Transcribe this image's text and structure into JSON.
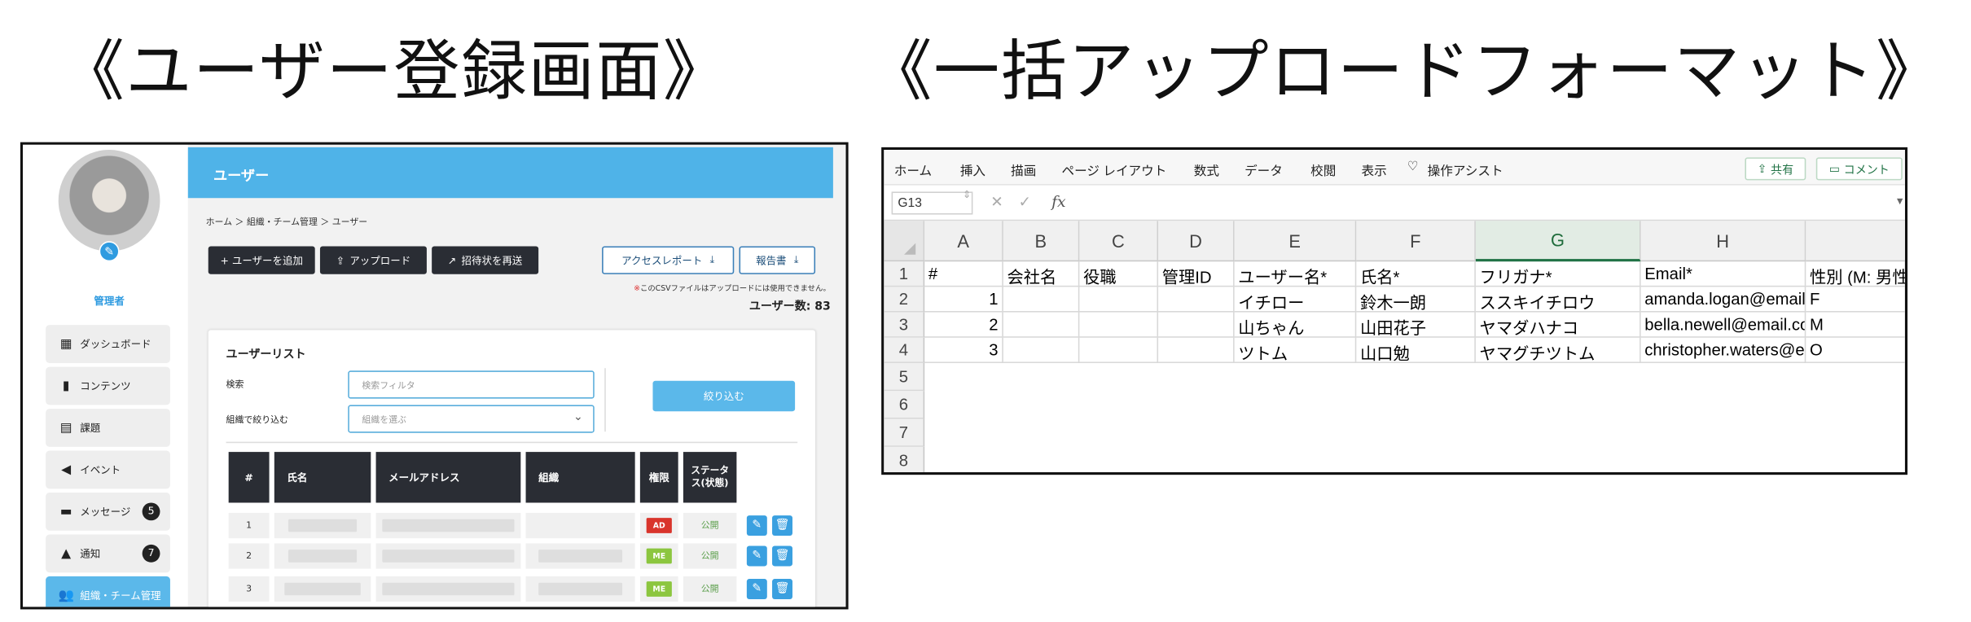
{
  "titles": {
    "left": "《ユーザー登録画面》",
    "right": "《一括アップロードフォーマット》"
  },
  "registration": {
    "role_label": "管理者",
    "nav": [
      {
        "label": "ダッシュボード",
        "icon": "grid-icon"
      },
      {
        "label": "コンテンツ",
        "icon": "book-icon"
      },
      {
        "label": "課題",
        "icon": "task-icon"
      },
      {
        "label": "イベント",
        "icon": "megaphone-icon"
      },
      {
        "label": "メッセージ",
        "icon": "chat-icon",
        "badge": "5"
      },
      {
        "label": "通知",
        "icon": "bell-icon",
        "badge": "7"
      },
      {
        "label": "組織・チーム管理",
        "icon": "people-icon",
        "active": true
      }
    ],
    "header_title": "ユーザー",
    "breadcrumb": "ホーム ＞ 組織・チーム管理 ＞ ユーザー",
    "buttons": {
      "add_user": "+ ユーザーを追加",
      "upload": "アップロード",
      "resend_invite": "招待状を再送",
      "access_report": "アクセスレポート",
      "report": "報告書"
    },
    "csv_note_mark": "※",
    "csv_note": "このCSVファイルはアップロードには使用できません。",
    "user_count": "ユーザー数: 83",
    "list": {
      "title": "ユーザーリスト",
      "search_label": "検索",
      "search_placeholder": "検索フィルタ",
      "org_filter_label": "組織で絞り込む",
      "org_filter_placeholder": "組織を選ぶ",
      "filter_button": "絞り込む",
      "columns": [
        "#",
        "氏名",
        "メールアドレス",
        "組織",
        "権限",
        "ステータス(状態)"
      ],
      "rows": [
        {
          "num": "1",
          "role": "AD",
          "role_color": "#d9342b",
          "status": "公開"
        },
        {
          "num": "2",
          "role": "ME",
          "role_color": "#8cc63f",
          "status": "公開"
        },
        {
          "num": "3",
          "role": "ME",
          "role_color": "#8cc63f",
          "status": "公開"
        }
      ]
    }
  },
  "spreadsheet": {
    "ribbon_tabs": [
      "ホーム",
      "挿入",
      "描画",
      "ページ レイアウト",
      "数式",
      "データ",
      "校閲",
      "表示",
      "操作アシスト"
    ],
    "share_button": "共有",
    "comment_button": "コメント",
    "name_box": "G13",
    "fx_label": "fx",
    "columns": [
      "A",
      "B",
      "C",
      "D",
      "E",
      "F",
      "G",
      "H"
    ],
    "selected_column": "G",
    "row_numbers": [
      "1",
      "2",
      "3",
      "4",
      "5",
      "6",
      "7",
      "8"
    ],
    "header_row": [
      "#",
      "会社名",
      "役職",
      "管理ID",
      "ユーザー名*",
      "氏名*",
      "フリガナ*",
      "Email*",
      "性別 (M: 男性"
    ],
    "data_rows": [
      [
        "1",
        "",
        "",
        "",
        "イチロー",
        "鈴木一朗",
        "ススキイチロウ",
        "amanda.logan@email.com",
        "F"
      ],
      [
        "2",
        "",
        "",
        "",
        "山ちゃん",
        "山田花子",
        "ヤマダハナコ",
        "bella.newell@email.com",
        "M"
      ],
      [
        "3",
        "",
        "",
        "",
        "ツトム",
        "山口勉",
        "ヤマグチツトム",
        "christopher.waters@email.com",
        "O"
      ]
    ],
    "accent_color": "#217346"
  }
}
